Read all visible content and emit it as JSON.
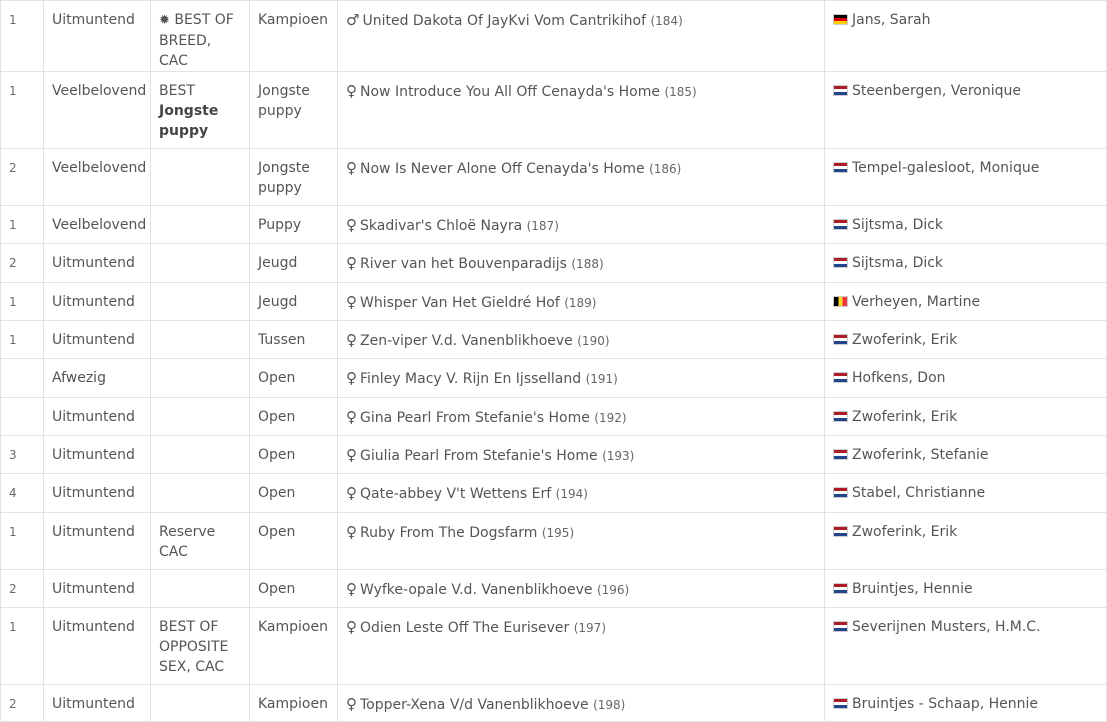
{
  "rows": [
    {
      "rank": "1",
      "grade": "Uitmuntend",
      "award": "BEST OF BREED, CAC",
      "award_icon": "✹",
      "award_bold": "",
      "class": "Kampioen",
      "sex": "♂",
      "dog": "United Dakota Of JayKvi Vom Cantrikihof",
      "num": "(184)",
      "flag": "de",
      "owner": "Jans, Sarah"
    },
    {
      "rank": "1",
      "grade": "Veelbelovend",
      "award": "BEST",
      "award_icon": "",
      "award_bold": "Jongste puppy",
      "class": "Jongste puppy",
      "sex": "♀",
      "dog": "Now Introduce You All Off Cenayda's Home",
      "num": "(185)",
      "flag": "nl",
      "owner": "Steenbergen, Veronique"
    },
    {
      "rank": "2",
      "grade": "Veelbelovend",
      "award": "",
      "award_icon": "",
      "award_bold": "",
      "class": "Jongste puppy",
      "sex": "♀",
      "dog": "Now Is Never Alone Off Cenayda's Home",
      "num": "(186)",
      "flag": "nl",
      "owner": "Tempel-galesloot, Monique"
    },
    {
      "rank": "1",
      "grade": "Veelbelovend",
      "award": "",
      "award_icon": "",
      "award_bold": "",
      "class": "Puppy",
      "sex": "♀",
      "dog": "Skadivar's Chloë Nayra",
      "num": "(187)",
      "flag": "nl",
      "owner": "Sijtsma, Dick"
    },
    {
      "rank": "2",
      "grade": "Uitmuntend",
      "award": "",
      "award_icon": "",
      "award_bold": "",
      "class": "Jeugd",
      "sex": "♀",
      "dog": "River van het Bouvenparadijs",
      "num": "(188)",
      "flag": "nl",
      "owner": "Sijtsma, Dick"
    },
    {
      "rank": "1",
      "grade": "Uitmuntend",
      "award": "",
      "award_icon": "",
      "award_bold": "",
      "class": "Jeugd",
      "sex": "♀",
      "dog": "Whisper Van Het Gieldré Hof",
      "num": "(189)",
      "flag": "be",
      "owner": "Verheyen, Martine"
    },
    {
      "rank": "1",
      "grade": "Uitmuntend",
      "award": "",
      "award_icon": "",
      "award_bold": "",
      "class": "Tussen",
      "sex": "♀",
      "dog": "Zen-viper V.d. Vanenblikhoeve",
      "num": "(190)",
      "flag": "nl",
      "owner": "Zwoferink, Erik"
    },
    {
      "rank": "",
      "grade": "Afwezig",
      "award": "",
      "award_icon": "",
      "award_bold": "",
      "class": "Open",
      "sex": "♀",
      "dog": "Finley Macy V. Rijn En Ijsselland",
      "num": "(191)",
      "flag": "nl",
      "owner": "Hofkens, Don"
    },
    {
      "rank": "",
      "grade": "Uitmuntend",
      "award": "",
      "award_icon": "",
      "award_bold": "",
      "class": "Open",
      "sex": "♀",
      "dog": "Gina Pearl From Stefanie's Home",
      "num": "(192)",
      "flag": "nl",
      "owner": "Zwoferink, Erik"
    },
    {
      "rank": "3",
      "grade": "Uitmuntend",
      "award": "",
      "award_icon": "",
      "award_bold": "",
      "class": "Open",
      "sex": "♀",
      "dog": "Giulia Pearl From Stefanie's Home",
      "num": "(193)",
      "flag": "nl",
      "owner": "Zwoferink, Stefanie"
    },
    {
      "rank": "4",
      "grade": "Uitmuntend",
      "award": "",
      "award_icon": "",
      "award_bold": "",
      "class": "Open",
      "sex": "♀",
      "dog": "Qate-abbey V't Wettens Erf",
      "num": "(194)",
      "flag": "nl",
      "owner": "Stabel, Christianne"
    },
    {
      "rank": "1",
      "grade": "Uitmuntend",
      "award": "Reserve CAC",
      "award_icon": "",
      "award_bold": "",
      "class": "Open",
      "sex": "♀",
      "dog": "Ruby From The Dogsfarm",
      "num": "(195)",
      "flag": "nl",
      "owner": "Zwoferink, Erik"
    },
    {
      "rank": "2",
      "grade": "Uitmuntend",
      "award": "",
      "award_icon": "",
      "award_bold": "",
      "class": "Open",
      "sex": "♀",
      "dog": "Wyfke-opale V.d. Vanenblikhoeve",
      "num": "(196)",
      "flag": "nl",
      "owner": "Bruintjes, Hennie"
    },
    {
      "rank": "1",
      "grade": "Uitmuntend",
      "award": "BEST OF OPPOSITE SEX, CAC",
      "award_icon": "",
      "award_bold": "",
      "class": "Kampioen",
      "sex": "♀",
      "dog": "Odien Leste Off The Eurisever",
      "num": "(197)",
      "flag": "nl",
      "owner": "Severijnen Musters, H.M.C."
    },
    {
      "rank": "2",
      "grade": "Uitmuntend",
      "award": "",
      "award_icon": "",
      "award_bold": "",
      "class": "Kampioen",
      "sex": "♀",
      "dog": "Topper-Xena V/d Vanenblikhoeve",
      "num": "(198)",
      "flag": "nl",
      "owner": "Bruintjes - Schaap, Hennie"
    }
  ]
}
